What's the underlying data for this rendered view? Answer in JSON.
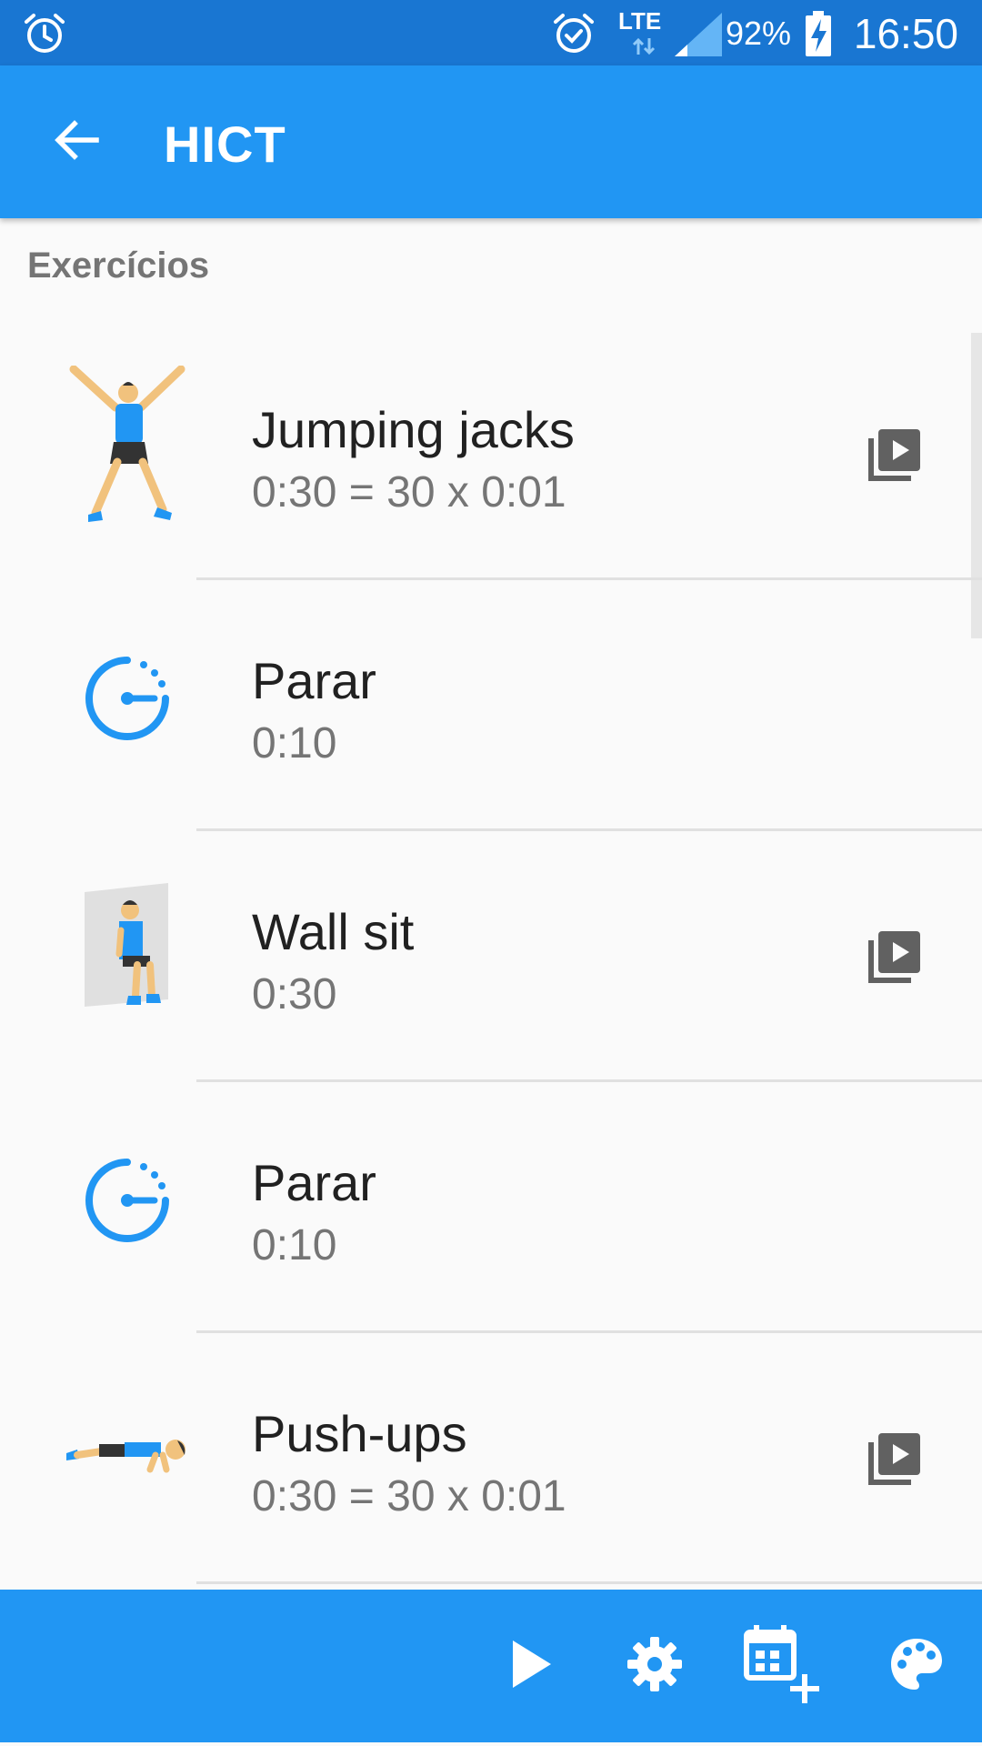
{
  "status_bar": {
    "network": "LTE",
    "battery_percent": "92%",
    "time": "16:50",
    "icons": [
      "alarm-icon",
      "alarm-check-icon",
      "lte-data-icon",
      "signal-icon",
      "battery-charging-icon"
    ]
  },
  "app_bar": {
    "title": "HICT",
    "back_icon": "arrow-back-icon"
  },
  "section": {
    "title": "Exercícios"
  },
  "exercises": [
    {
      "name": "Jumping jacks",
      "duration": "0:30 = 30 x 0:01",
      "thumb": "jumping-jacks-figure",
      "has_video": true
    },
    {
      "name": "Parar",
      "duration": "0:10",
      "thumb": "timer-icon",
      "has_video": false
    },
    {
      "name": "Wall sit",
      "duration": "0:30",
      "thumb": "wall-sit-figure",
      "has_video": true
    },
    {
      "name": "Parar",
      "duration": "0:10",
      "thumb": "timer-icon",
      "has_video": false
    },
    {
      "name": "Push-ups",
      "duration": "0:30 = 30 x 0:01",
      "thumb": "push-ups-figure",
      "has_video": true
    }
  ],
  "bottom_bar": {
    "actions": [
      "play-icon",
      "settings-gear-icon",
      "calendar-add-icon",
      "palette-icon"
    ]
  },
  "colors": {
    "status_bar": "#1976d2",
    "primary": "#2196f3",
    "accent_icon": "#2196f3",
    "text_primary": "#212121",
    "text_secondary": "#757575"
  }
}
